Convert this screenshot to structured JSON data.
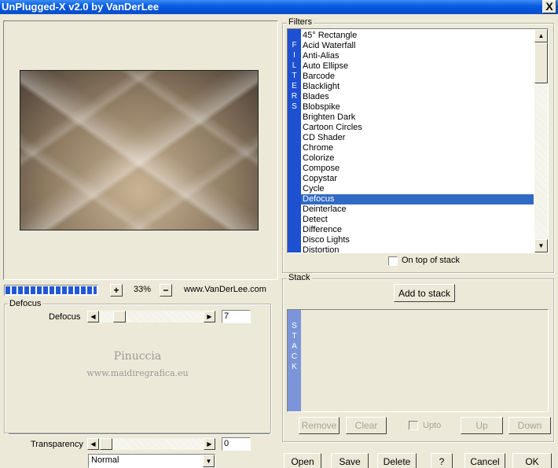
{
  "window": {
    "title": "UnPlugged-X v2.0 by VanDerLee",
    "close_glyph": "X"
  },
  "preview": {
    "progress_fraction": 1.0,
    "zoom_in_label": "+",
    "zoom_value": "33%",
    "zoom_out_label": "−",
    "website": "www.VanDerLee.com"
  },
  "filters": {
    "group_label": "Filters",
    "side_label": [
      "F",
      "I",
      "L",
      "T",
      "E",
      "R",
      "S"
    ],
    "items": [
      "45° Rectangle",
      "Acid Waterfall",
      "Anti-Alias",
      "Auto Ellipse",
      "Barcode",
      "Blacklight",
      "Blades",
      "Blobspike",
      "Brighten Dark",
      "Cartoon Circles",
      "CD Shader",
      "Chrome",
      "Colorize",
      "Compose",
      "Copystar",
      "Cycle",
      "Defocus",
      "Deinterlace",
      "Detect",
      "Difference",
      "Disco Lights",
      "Distortion"
    ],
    "selected": "Defocus",
    "on_top_label": "On top of stack",
    "on_top_checked": false
  },
  "stack": {
    "group_label": "Stack",
    "add_label": "Add to stack",
    "side_label": [
      "S",
      "T",
      "A",
      "C",
      "K"
    ],
    "remove_label": "Remove",
    "clear_label": "Clear",
    "upto_label": "Upto",
    "up_label": "Up",
    "down_label": "Down"
  },
  "params": {
    "group_label": "Defocus",
    "defocus_label": "Defocus",
    "defocus_value": "7",
    "watermark_line1": "Pinuccia",
    "watermark_line2": "www.maidiregrafica.eu",
    "transparency_label": "Transparency",
    "transparency_value": "0",
    "blend_mode": "Normal"
  },
  "footer": {
    "open_label": "Open",
    "save_label": "Save",
    "delete_label": "Delete",
    "help_label": "?",
    "cancel_label": "Cancel",
    "ok_label": "OK"
  },
  "colors": {
    "title_blue": "#0552d6",
    "selection": "#316ac5",
    "side_bar": "#1e50d2",
    "stack_bar": "#7b95d8"
  }
}
